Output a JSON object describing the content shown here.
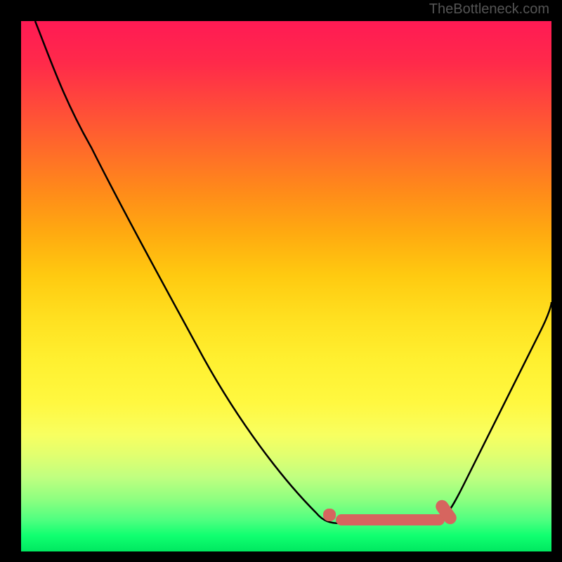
{
  "watermark": "TheBottleneck.com",
  "chart_data": {
    "type": "line",
    "title": "",
    "xlabel": "",
    "ylabel": "",
    "xlim": [
      0,
      100
    ],
    "ylim": [
      0,
      100
    ],
    "grid": false,
    "legend": false,
    "series": [
      {
        "name": "curve",
        "x": [
          3,
          8,
          15,
          22,
          30,
          38,
          45,
          52,
          57,
          60,
          62,
          65,
          70,
          75,
          80,
          83,
          87,
          92,
          97,
          100
        ],
        "y": [
          100,
          92,
          80,
          68,
          55,
          42,
          30,
          18,
          10,
          5,
          4,
          5,
          5,
          5,
          6,
          10,
          18,
          30,
          42,
          50
        ]
      }
    ],
    "highlight": {
      "name": "optimal-range",
      "color": "#d6655f",
      "x_start": 57,
      "x_end": 82,
      "y_approx": 5
    },
    "background_gradient": {
      "top_color": "#ff1a54",
      "bottom_color": "#00e860",
      "stops": [
        "red",
        "orange",
        "yellow",
        "green"
      ]
    }
  }
}
